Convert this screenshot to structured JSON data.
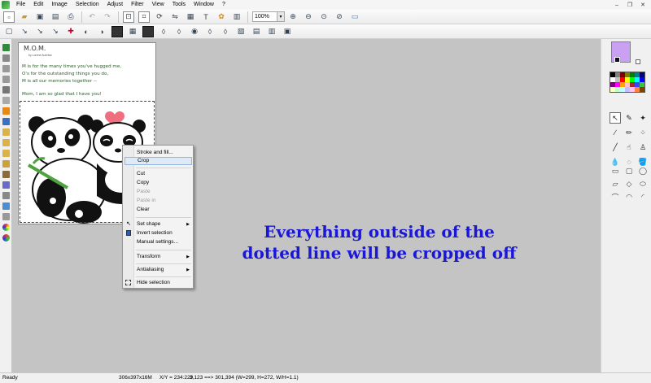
{
  "menubar": {
    "items": [
      "File",
      "Edit",
      "Image",
      "Selection",
      "Adjust",
      "Filter",
      "View",
      "Tools",
      "Window",
      "?"
    ]
  },
  "window_controls": {
    "minimize": "–",
    "restore": "❐",
    "close": "✕"
  },
  "toolbar": {
    "zoom_value": "100%",
    "icons_row1": [
      "new-icon",
      "open-icon",
      "save-icon",
      "scanner-icon",
      "print-icon",
      "undo-icon",
      "redo-icon",
      "resize-icon",
      "crop-icon",
      "rotate-icon",
      "flip-icon",
      "canvas-icon",
      "text-icon",
      "filter-icon",
      "effects-icon"
    ],
    "icons_row2": [
      "select-rect-icon",
      "select-lasso-icon",
      "select-wand-icon",
      "select-add-icon",
      "color-balance-icon",
      "contrast-icon",
      "levels-icon",
      "channels-icon",
      "grid-icon",
      "mask-icon",
      "drop-icon",
      "drop-outline-icon",
      "brightness-icon",
      "blur-icon",
      "sharpen-icon",
      "layers-icon",
      "copy-icon",
      "paste-icon",
      "screenshot-icon"
    ]
  },
  "document": {
    "title": "M.O.M.",
    "byline": "by Lorene Auerbar",
    "poem_lines": [
      "M is for the many times you've hugged me,",
      "O's for the outstanding things you do,",
      "M is all our memories together --",
      "Mom, I am so glad that I have you!"
    ]
  },
  "context_menu": {
    "items": [
      {
        "label": "Stroke and fill...",
        "enabled": true
      },
      {
        "label": "Crop",
        "enabled": true,
        "highlighted": true
      },
      {
        "label": "Cut",
        "enabled": true
      },
      {
        "label": "Copy",
        "enabled": true
      },
      {
        "label": "Paste",
        "enabled": false
      },
      {
        "label": "Paste in",
        "enabled": false
      },
      {
        "label": "Clear",
        "enabled": true
      },
      {
        "label": "Set shape",
        "enabled": true,
        "submenu": true
      },
      {
        "label": "Invert selection",
        "enabled": true
      },
      {
        "label": "Manual settings...",
        "enabled": true
      },
      {
        "label": "Transform",
        "enabled": true,
        "submenu": true
      },
      {
        "label": "Antialiasing",
        "enabled": true,
        "submenu": true
      },
      {
        "label": "Hide selection",
        "enabled": true
      }
    ],
    "submenu_arrow": "▶"
  },
  "annotation": {
    "line1": "Everything outside of the",
    "line2": "dotted line will be cropped off"
  },
  "colors": {
    "foreground": "#c9a0f2",
    "annotation": "#1a18d6",
    "workspace": "#c4c4c4",
    "palette": [
      "#000000",
      "#808080",
      "#800000",
      "#808000",
      "#008000",
      "#008080",
      "#000080",
      "#ffffff",
      "#c0c0c0",
      "#ff0000",
      "#ffff00",
      "#00ff00",
      "#00ffff",
      "#0000ff",
      "#800080",
      "#ff00ff",
      "#ffa500",
      "#ffc0cb",
      "#a52a2a",
      "#4040ff",
      "#40c040",
      "#ffffc0",
      "#c0ffc0",
      "#c0ffff",
      "#c0c0ff",
      "#ffc0ff",
      "#ff8040",
      "#804000"
    ]
  },
  "tools": {
    "paint": [
      "pointer",
      "eyedropper",
      "magic-wand",
      "pencil",
      "brush",
      "airbrush",
      "line",
      "smudge",
      "stamp",
      "drop",
      "eraser",
      "bucket"
    ],
    "paint_glyphs": [
      "↖",
      "✎",
      "✦",
      "∕",
      "✏",
      "⁘",
      "╱",
      "☝",
      "♙",
      "💧",
      "◌",
      "🪣"
    ],
    "shapes": [
      "▭",
      "▢",
      "◯",
      "▱",
      "◇",
      "⬭",
      "⌒",
      "◠",
      "◜"
    ]
  },
  "statusbar": {
    "status": "Ready",
    "image_size": "306x397x16M",
    "cursor": "X/Y = 234:229",
    "selection": "3,123 ==> 301,394 (W=299, H=272, W/H=1.1)"
  }
}
